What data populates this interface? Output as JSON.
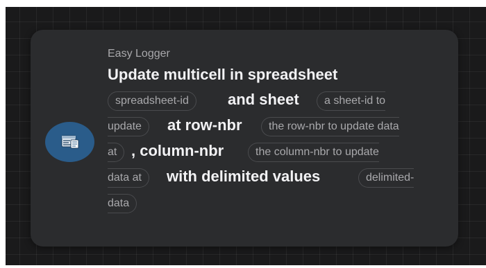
{
  "node": {
    "subtitle": "Easy Logger",
    "title": "Update multicell in spreadsheet",
    "icon": "spreadsheet-log-icon",
    "sentence": {
      "spreadsheet_chip": "spreadsheet-id",
      "and_sheet": "and sheet",
      "sheet_chip_part1": "a sheet-id to",
      "sheet_chip_part2": "update",
      "at_row": "at row-nbr",
      "row_chip_part1": "the row-nbr to update data",
      "row_chip_part2": "at",
      "column": ", column-nbr",
      "column_chip_part1": "the column-nbr to update",
      "column_chip_part2": "data at",
      "with_values": "with delimited values",
      "data_chip_part1": "delimited-",
      "data_chip_part2": "data"
    }
  },
  "colors": {
    "canvas": "#1a1a1b",
    "card": "#2b2c2e",
    "icon_circle": "#2a5c8a",
    "bold_text": "#f2f2f4",
    "muted_text": "#a9a9ac"
  }
}
